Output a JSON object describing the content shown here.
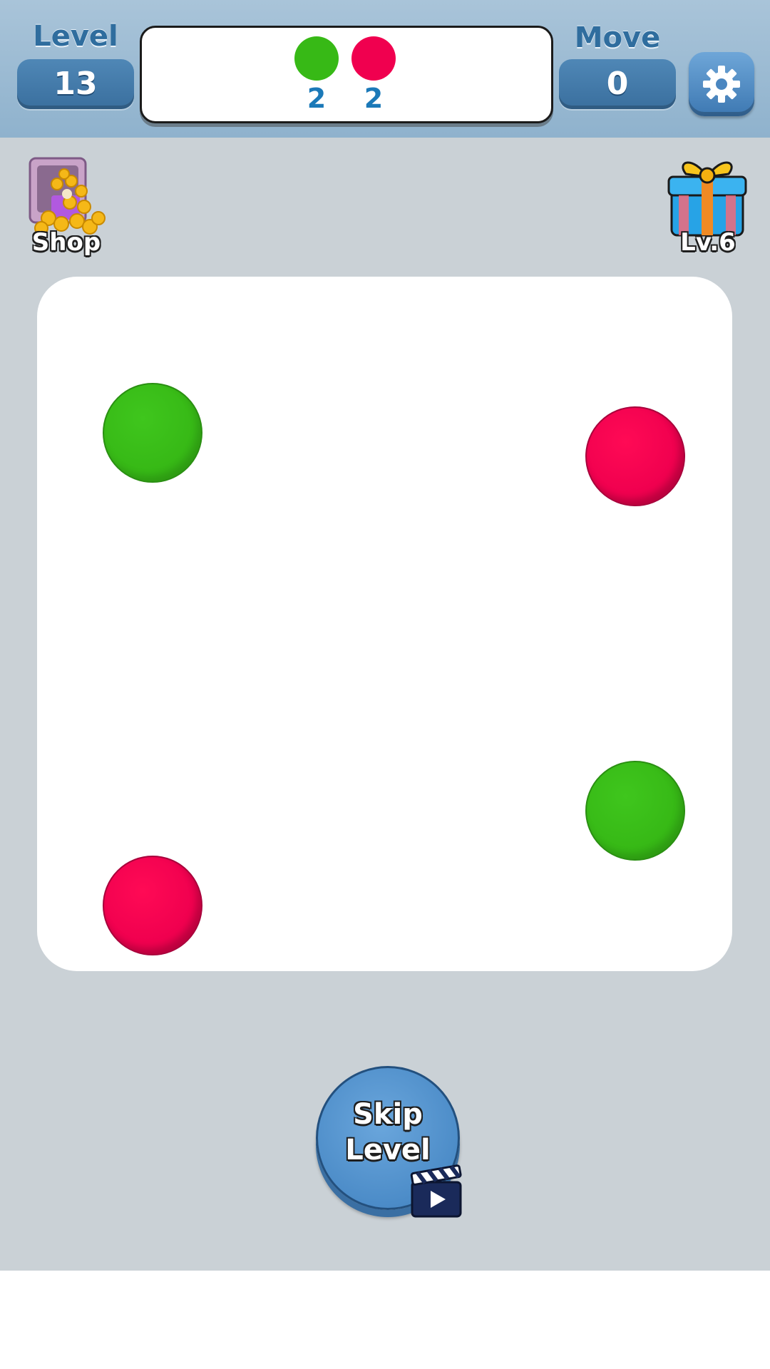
{
  "header": {
    "level_label": "Level",
    "level_value": "13",
    "move_label": "Move",
    "move_value": "0",
    "settings_icon": "gear-icon"
  },
  "goals": [
    {
      "color": "#37b916",
      "count": "2"
    },
    {
      "color": "#f0004f",
      "count": "2"
    }
  ],
  "shop": {
    "label": "Shop",
    "icon": "treasure-safe-icon"
  },
  "gift": {
    "label": "Lv.6",
    "icon": "gift-box-icon"
  },
  "board": {
    "balls": [
      {
        "color": "green"
      },
      {
        "color": "red"
      },
      {
        "color": "green"
      },
      {
        "color": "red"
      }
    ]
  },
  "skip": {
    "line1": "Skip",
    "line2": "Level",
    "icon": "video-clapperboard-icon"
  }
}
